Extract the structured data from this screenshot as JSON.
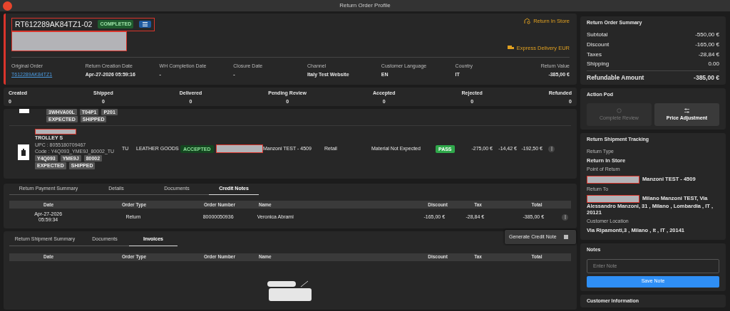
{
  "window": {
    "title": "Return Order Profile"
  },
  "header": {
    "order_id": "RT612289AK84TZ1-02",
    "status": "COMPLETED",
    "return_type": "Return In Store",
    "delivery": "Express Delivery EUR",
    "fields": [
      {
        "label": "Original Order",
        "value": "T612289AK84TZ1",
        "kind": "link"
      },
      {
        "label": "Return Creation Date",
        "value": "Apr-27-2026 05:59:16",
        "kind": "text"
      },
      {
        "label": "WH Completion Date",
        "value": "-",
        "kind": "text"
      },
      {
        "label": "Closure Date",
        "value": "-",
        "kind": "text"
      },
      {
        "label": "Channel",
        "value": "Italy Test Website",
        "kind": "text"
      },
      {
        "label": "Customer Language",
        "value": "EN",
        "kind": "text"
      },
      {
        "label": "Country",
        "value": "IT",
        "kind": "text"
      },
      {
        "label": "Return Value",
        "value": "-385,00 €",
        "kind": "text"
      }
    ]
  },
  "counters": [
    {
      "label": "Created",
      "value": "0"
    },
    {
      "label": "Shipped",
      "value": "0"
    },
    {
      "label": "Delivered",
      "value": "0"
    },
    {
      "label": "Pending Review",
      "value": "0"
    },
    {
      "label": "Accepted",
      "value": "0"
    },
    {
      "label": "Rejected",
      "value": "0"
    },
    {
      "label": "Refunded",
      "value": "0"
    }
  ],
  "items": [
    {
      "kind": "partial",
      "tags": [
        "3WHVA00L",
        "T04P1",
        "P201"
      ],
      "states": [
        "EXPECTED",
        "SHIPPED"
      ]
    },
    {
      "kind": "full",
      "name": "TROLLEY S",
      "upc": "UPC : 8055180709467",
      "code": "Code : Y4Q093_YME9J_80002_TU",
      "tags": [
        "Y4Q093",
        "YME9J",
        "80002"
      ],
      "states": [
        "EXPECTED",
        "SHIPPED"
      ],
      "size": "TU",
      "category": "LEATHER GOODS",
      "status": "ACCEPTED",
      "store": "Manzoni TEST - 4509",
      "channel": "Retail",
      "reason": "Material Not Expected",
      "check": "PASS",
      "price": "-275,00 €",
      "tax": "-14,42 €",
      "total": "-192,50 €"
    }
  ],
  "payment": {
    "tabs": [
      {
        "label": "Return Payment Summary",
        "selected": false
      },
      {
        "label": "Details",
        "selected": false
      },
      {
        "label": "Documents",
        "selected": false
      },
      {
        "label": "Credit Notes",
        "selected": true
      }
    ],
    "columns": [
      "Date",
      "Order Type",
      "Order Number",
      "Name",
      "Discount",
      "Tax",
      "Total"
    ],
    "rows": [
      {
        "date": "Apr-27-2026",
        "time": "05:59:34",
        "order_type": "Return",
        "order_number": "80000050936",
        "name": "Veronica Abrami",
        "discount": "-165,00 €",
        "tax": "-28,84 €",
        "total": "-385,00 €"
      }
    ],
    "menu": [
      "Generate Credit Note"
    ]
  },
  "shipment": {
    "tabs": [
      {
        "label": "Return Shipment Summary",
        "selected": false
      },
      {
        "label": "Documents",
        "selected": false
      },
      {
        "label": "Invoices",
        "selected": true
      }
    ],
    "columns": [
      "Date",
      "Order Type",
      "Order Number",
      "Name",
      "Discount",
      "Tax",
      "Total"
    ]
  },
  "summary": {
    "title": "Return Order Summary",
    "rows": [
      {
        "label": "Subtotal",
        "value": "-550,00 €"
      },
      {
        "label": "Discount",
        "value": "-165,00 €"
      },
      {
        "label": "Taxes",
        "value": "-28,84 €"
      },
      {
        "label": "Shipping",
        "value": "0.00"
      }
    ],
    "total_label": "Refundable Amount",
    "total_value": "-385,00 €"
  },
  "action_pod": {
    "title": "Action Pod",
    "buttons": [
      {
        "label": "Complete Review",
        "disabled": true,
        "kind": "review"
      },
      {
        "label": "Price Adjustment",
        "disabled": false,
        "kind": "adjust"
      }
    ]
  },
  "tracking": {
    "title": "Return Shipment Tracking",
    "fields": [
      {
        "label": "Return Type",
        "value": "Return In Store",
        "redacted": false
      },
      {
        "label": "Point of Return",
        "value": "Manzoni TEST - 4509",
        "redacted": true
      },
      {
        "label": "Return To",
        "value": "Milano Manzoni TEST, Via Alessandro Manzoni, 31 , Milano , Lombardia , IT , 20121",
        "redacted": true
      },
      {
        "label": "Customer Location",
        "value": "Via Ripamonti,3 , Milano , it , IT , 20141",
        "redacted": false
      }
    ]
  },
  "notes": {
    "title": "Notes",
    "placeholder": "Enter Note",
    "button": "Save Note"
  },
  "customer": {
    "title": "Customer Information"
  }
}
